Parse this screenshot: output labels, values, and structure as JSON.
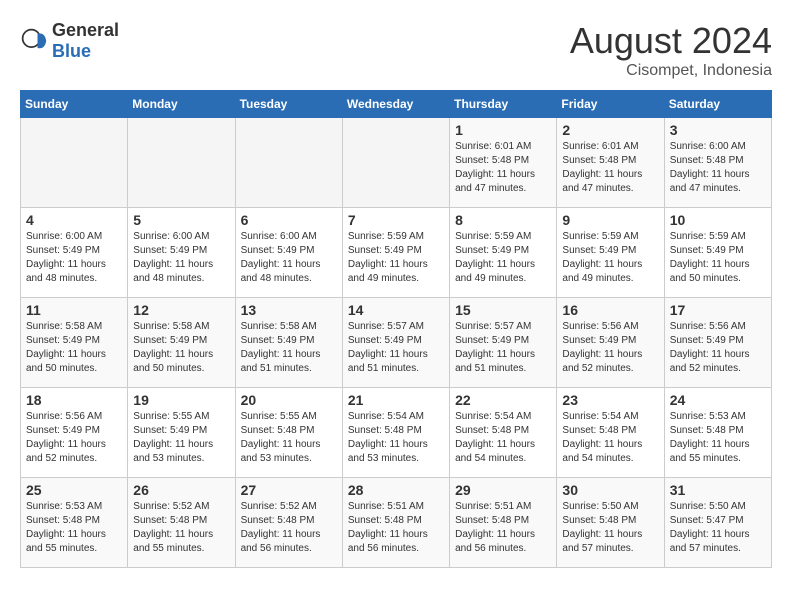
{
  "header": {
    "logo_general": "General",
    "logo_blue": "Blue",
    "month_title": "August 2024",
    "subtitle": "Cisompet, Indonesia"
  },
  "weekdays": [
    "Sunday",
    "Monday",
    "Tuesday",
    "Wednesday",
    "Thursday",
    "Friday",
    "Saturday"
  ],
  "weeks": [
    [
      {
        "day": "",
        "info": ""
      },
      {
        "day": "",
        "info": ""
      },
      {
        "day": "",
        "info": ""
      },
      {
        "day": "",
        "info": ""
      },
      {
        "day": "1",
        "info": "Sunrise: 6:01 AM\nSunset: 5:48 PM\nDaylight: 11 hours\nand 47 minutes."
      },
      {
        "day": "2",
        "info": "Sunrise: 6:01 AM\nSunset: 5:48 PM\nDaylight: 11 hours\nand 47 minutes."
      },
      {
        "day": "3",
        "info": "Sunrise: 6:00 AM\nSunset: 5:48 PM\nDaylight: 11 hours\nand 47 minutes."
      }
    ],
    [
      {
        "day": "4",
        "info": "Sunrise: 6:00 AM\nSunset: 5:49 PM\nDaylight: 11 hours\nand 48 minutes."
      },
      {
        "day": "5",
        "info": "Sunrise: 6:00 AM\nSunset: 5:49 PM\nDaylight: 11 hours\nand 48 minutes."
      },
      {
        "day": "6",
        "info": "Sunrise: 6:00 AM\nSunset: 5:49 PM\nDaylight: 11 hours\nand 48 minutes."
      },
      {
        "day": "7",
        "info": "Sunrise: 5:59 AM\nSunset: 5:49 PM\nDaylight: 11 hours\nand 49 minutes."
      },
      {
        "day": "8",
        "info": "Sunrise: 5:59 AM\nSunset: 5:49 PM\nDaylight: 11 hours\nand 49 minutes."
      },
      {
        "day": "9",
        "info": "Sunrise: 5:59 AM\nSunset: 5:49 PM\nDaylight: 11 hours\nand 49 minutes."
      },
      {
        "day": "10",
        "info": "Sunrise: 5:59 AM\nSunset: 5:49 PM\nDaylight: 11 hours\nand 50 minutes."
      }
    ],
    [
      {
        "day": "11",
        "info": "Sunrise: 5:58 AM\nSunset: 5:49 PM\nDaylight: 11 hours\nand 50 minutes."
      },
      {
        "day": "12",
        "info": "Sunrise: 5:58 AM\nSunset: 5:49 PM\nDaylight: 11 hours\nand 50 minutes."
      },
      {
        "day": "13",
        "info": "Sunrise: 5:58 AM\nSunset: 5:49 PM\nDaylight: 11 hours\nand 51 minutes."
      },
      {
        "day": "14",
        "info": "Sunrise: 5:57 AM\nSunset: 5:49 PM\nDaylight: 11 hours\nand 51 minutes."
      },
      {
        "day": "15",
        "info": "Sunrise: 5:57 AM\nSunset: 5:49 PM\nDaylight: 11 hours\nand 51 minutes."
      },
      {
        "day": "16",
        "info": "Sunrise: 5:56 AM\nSunset: 5:49 PM\nDaylight: 11 hours\nand 52 minutes."
      },
      {
        "day": "17",
        "info": "Sunrise: 5:56 AM\nSunset: 5:49 PM\nDaylight: 11 hours\nand 52 minutes."
      }
    ],
    [
      {
        "day": "18",
        "info": "Sunrise: 5:56 AM\nSunset: 5:49 PM\nDaylight: 11 hours\nand 52 minutes."
      },
      {
        "day": "19",
        "info": "Sunrise: 5:55 AM\nSunset: 5:49 PM\nDaylight: 11 hours\nand 53 minutes."
      },
      {
        "day": "20",
        "info": "Sunrise: 5:55 AM\nSunset: 5:48 PM\nDaylight: 11 hours\nand 53 minutes."
      },
      {
        "day": "21",
        "info": "Sunrise: 5:54 AM\nSunset: 5:48 PM\nDaylight: 11 hours\nand 53 minutes."
      },
      {
        "day": "22",
        "info": "Sunrise: 5:54 AM\nSunset: 5:48 PM\nDaylight: 11 hours\nand 54 minutes."
      },
      {
        "day": "23",
        "info": "Sunrise: 5:54 AM\nSunset: 5:48 PM\nDaylight: 11 hours\nand 54 minutes."
      },
      {
        "day": "24",
        "info": "Sunrise: 5:53 AM\nSunset: 5:48 PM\nDaylight: 11 hours\nand 55 minutes."
      }
    ],
    [
      {
        "day": "25",
        "info": "Sunrise: 5:53 AM\nSunset: 5:48 PM\nDaylight: 11 hours\nand 55 minutes."
      },
      {
        "day": "26",
        "info": "Sunrise: 5:52 AM\nSunset: 5:48 PM\nDaylight: 11 hours\nand 55 minutes."
      },
      {
        "day": "27",
        "info": "Sunrise: 5:52 AM\nSunset: 5:48 PM\nDaylight: 11 hours\nand 56 minutes."
      },
      {
        "day": "28",
        "info": "Sunrise: 5:51 AM\nSunset: 5:48 PM\nDaylight: 11 hours\nand 56 minutes."
      },
      {
        "day": "29",
        "info": "Sunrise: 5:51 AM\nSunset: 5:48 PM\nDaylight: 11 hours\nand 56 minutes."
      },
      {
        "day": "30",
        "info": "Sunrise: 5:50 AM\nSunset: 5:48 PM\nDaylight: 11 hours\nand 57 minutes."
      },
      {
        "day": "31",
        "info": "Sunrise: 5:50 AM\nSunset: 5:47 PM\nDaylight: 11 hours\nand 57 minutes."
      }
    ]
  ]
}
